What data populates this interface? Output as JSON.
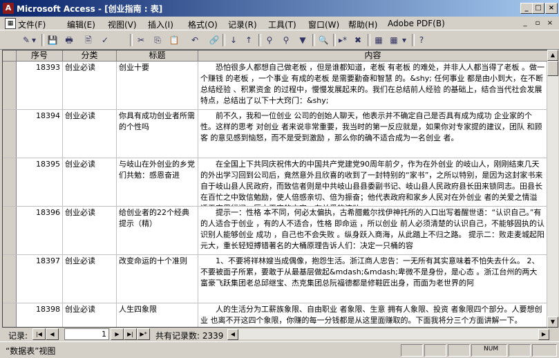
{
  "window": {
    "title": "Microsoft Access - [创业指南 : 表]",
    "app_icon_glyph": "A",
    "controls": [
      "_",
      "□",
      "×"
    ]
  },
  "menu": {
    "items": [
      "文件(F)",
      "编辑(E)",
      "视图(V)",
      "插入(I)",
      "格式(O)",
      "记录(R)",
      "工具(T)",
      "窗口(W)",
      "帮助(H)",
      "Adobe PDF(B)"
    ],
    "mdi_controls": [
      "_",
      "▫",
      "×"
    ]
  },
  "toolbar": {
    "icons": [
      "design-view-icon",
      "save-icon",
      "print-icon",
      "print-preview-icon",
      "spell-check-icon",
      "cut-icon",
      "copy-icon",
      "paste-icon",
      "undo-icon",
      "hyperlink-icon",
      "sort-ascending-icon",
      "sort-descending-icon",
      "filter-by-selection-icon",
      "filter-by-form-icon",
      "apply-filter-icon",
      "find-icon",
      "new-record-icon",
      "delete-record-icon",
      "database-window-icon",
      "new-object-icon",
      "help-icon"
    ],
    "glyphs": [
      "✎",
      "▾",
      "💾",
      "🖶",
      "🖹",
      "✓",
      "✂",
      "⎘",
      "📋",
      "↶",
      "🔗",
      "↓",
      "↑",
      "⚲",
      "⚲",
      "▼",
      "🔍",
      "▸*",
      "✖",
      "▦",
      "▾",
      "?"
    ]
  },
  "table": {
    "columns": [
      "序号",
      "分类",
      "标题",
      "内容"
    ],
    "rows": [
      {
        "id": "18393",
        "category": "创业必读",
        "title": "创业十要",
        "content": "恐怕很多人都想自己做老板 ，但是谁都知道，老板 有老板 的难处，并非人人都当得了老板 。做一个赚钱 的老板 ，一个事业 有成的老板 是需要勤奋和智慧 的。&shy; 任何事业 都是由小到大，在不断总结经验 、积累资金 的过程中，慢慢发展起来的。我们在总结前人经验 的基础上，结合当代社会发展特点，总结出了以下十大窍门：&shy;"
      },
      {
        "id": "18394",
        "category": "创业必读",
        "title": "你具有成功创业者所需的个性吗",
        "content": "前不久，我和一位创业 公司的创始人聊天，他表示并不确定自己是否具有成为成功 企业家的个性。这样的思考 对创业 者来说非常重要，我当时的第一反应就是，如果你对专家提的建议，团队 和顾客 的意见感到恼怒，而不是受到激励 ，那么你的确不适合成为一名创业 者。"
      },
      {
        "id": "18395",
        "category": "创业必读",
        "title": "与岐山在外创业的乡党们共勉：感恩奋进",
        "content": "在全国上下共同庆祝伟大的中国共产党建党90周年前夕，作为在外创业 的岐山人，刚刚结束几天的外出学习回到公司后，竟然意外且欣喜的收到了一封特别的“家书”，之所以特别，是因为这封家书来自于岐山县人民政府，而致信者则是中共岐山县县委副书记、岐山县人民政府县长田来锁同志。田县长在百忙之中致信勉励，使人倍感亲切、倍为振奋；他代表政府和家乡人民对在外创业 者的关爱之情溢透于字里行间，厚本平实的文字，在关爱的流动"
      },
      {
        "id": "18396",
        "category": "创业必读",
        "title": "给创业者的22个经典提示（精）",
        "content": "提示一：性格 本不同，何必太偏执，古希腊戴尔找伊神托所的入口出写着醒世语：“认识自己。”有的人适合于创业 ，有的人不适合，性格 即命运 ，所以创业 前人必须清楚的认识自己，不能够固执的认识别人能够创业 成功 ，自己也不会失败 。纵身跃入商海，从此踏上不归之路。 提示二：败走麦城起阳元大，重长轻短搏错著名的大桶原理告诉人们：决定一只桶的容"
      },
      {
        "id": "18397",
        "category": "创业必读",
        "title": "改变命运的十个准则",
        "content": "1、不要将祥林嫂当成偶像，抱怨生活。浙江商人忠告：一无所有其实意味着不怕失去什么。 2、不要被面子所累，要敢于从最基层做起&mdash;&mdash;卑微不是身份，是心态 。浙江台州的两大富豪飞跃集团老总邱继宝、杰克集团总阮福德都是修鞋匠出身，而面为老世界的阿"
      },
      {
        "id": "18398",
        "category": "创业必读",
        "title": "人生四象限",
        "content": "人的生活分为工薪族象限、自由职业 者象限、生意 拥有人象限、投资 者象限四个部分。人要想创业 也离不开这四个象限，你赚的每一分钱都是从这里面赚取的。下面我将分三个方面讲解一下。"
      }
    ]
  },
  "navigation": {
    "label": "记录:",
    "current_record": "1",
    "total_label": "共有记录数: 2339",
    "buttons": [
      "|◀",
      "◀",
      "▶",
      "▶|",
      "▶*"
    ]
  },
  "scrollbars": {
    "up": "▲",
    "down": "▼",
    "left": "◀",
    "right": "▶"
  },
  "status": {
    "view": "“数据表”视图",
    "indicator": "NUM"
  }
}
